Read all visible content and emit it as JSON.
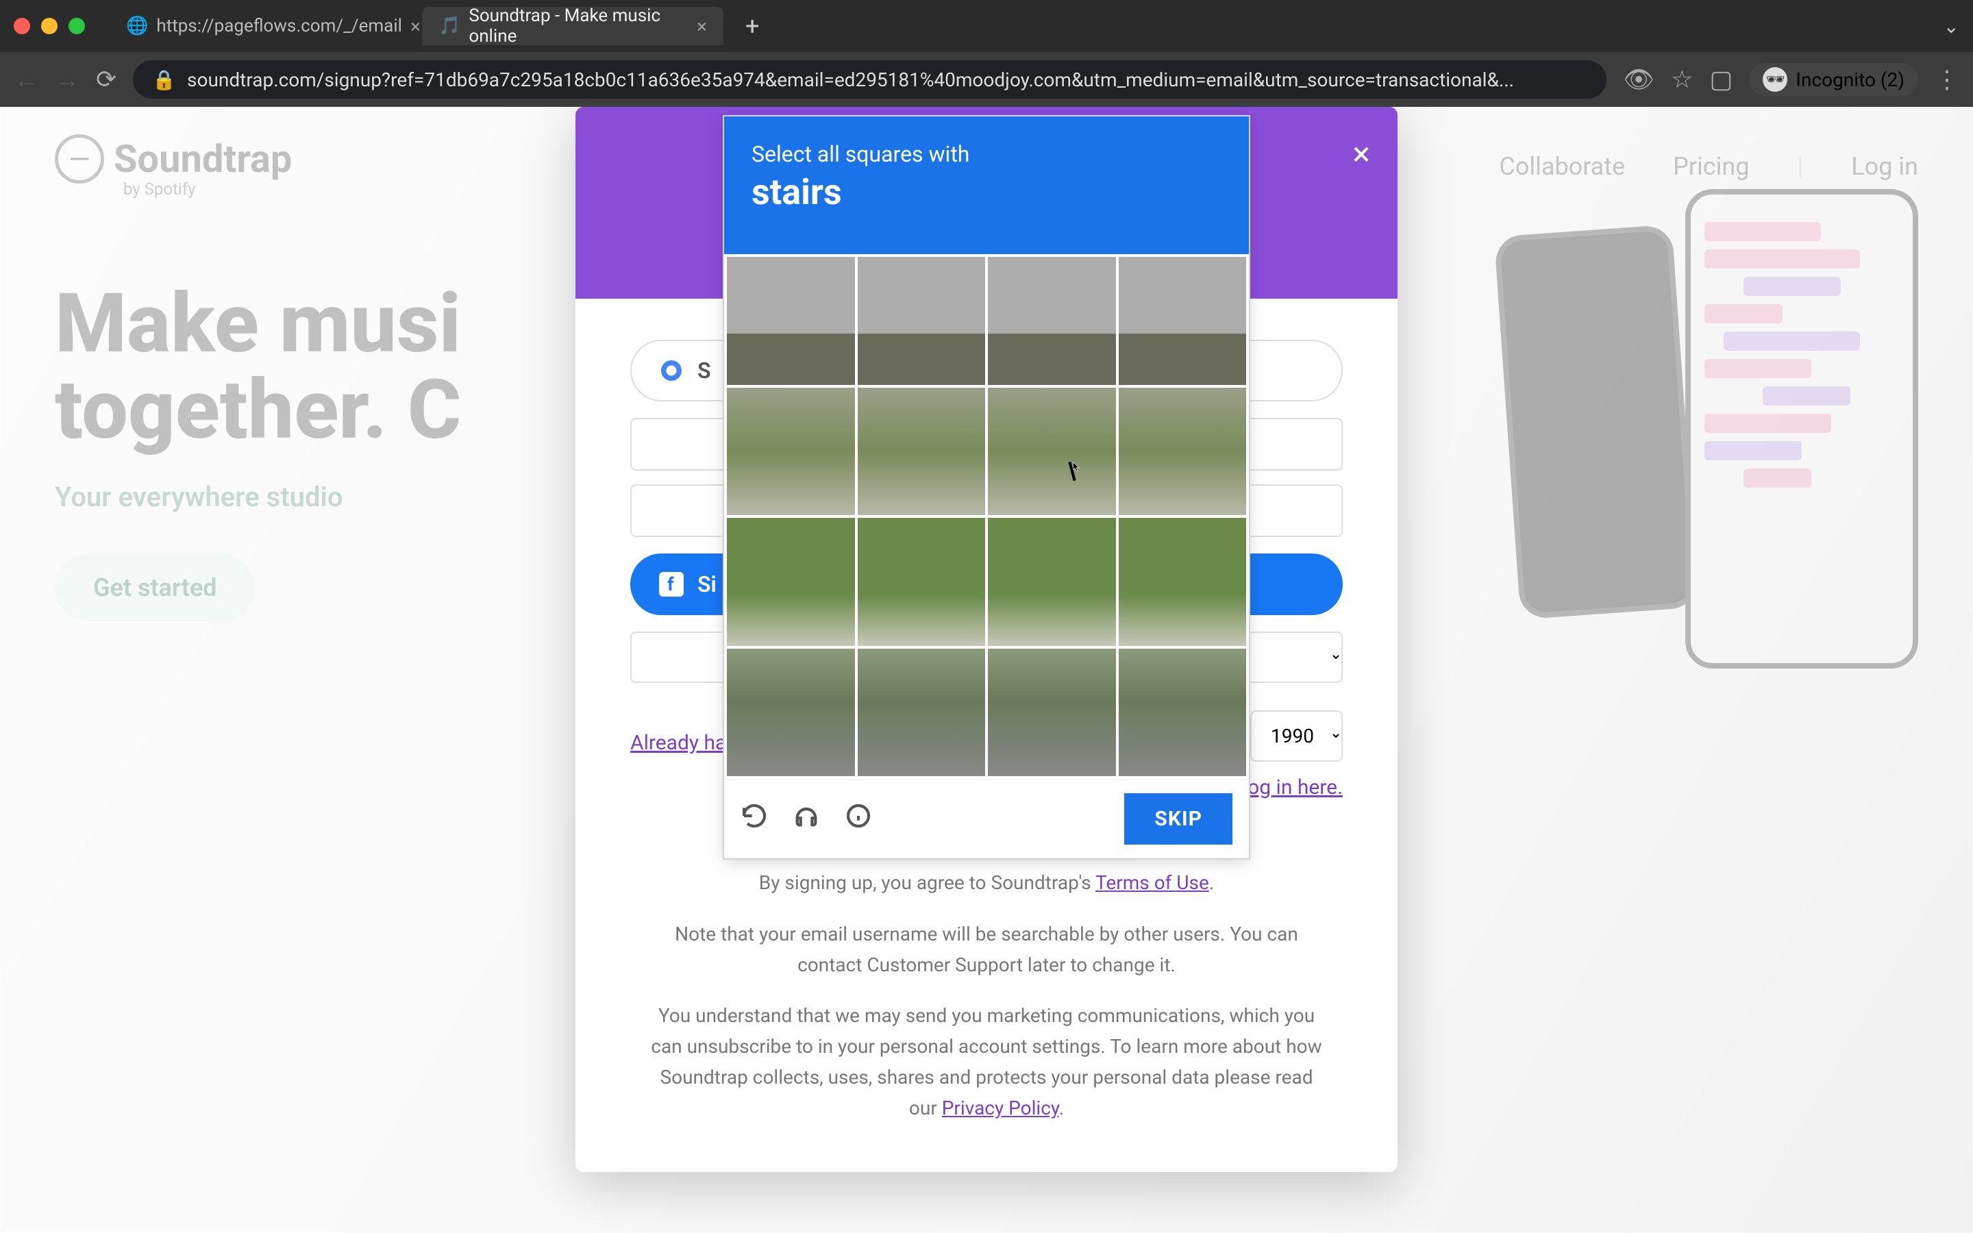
{
  "browser": {
    "tabs": [
      {
        "title": "https://pageflows.com/_/email",
        "active": false
      },
      {
        "title": "Soundtrap - Make music online",
        "active": true
      }
    ],
    "url": "soundtrap.com/signup?ref=71db69a7c295a18cb0c11a636e35a974&email=ed295181%40moodjoy.com&utm_medium=email&utm_source=transactional&...",
    "incognito_label": "Incognito (2)"
  },
  "site": {
    "logo_text": "Soundtrap",
    "logo_sub": "by Spotify",
    "nav": {
      "collaborate": "Collaborate",
      "pricing": "Pricing",
      "login": "Log in"
    },
    "hero_title_line1": "Make musi",
    "hero_title_line2": "together. C",
    "hero_sub": "Your everywhere studio",
    "get_started": "Get started"
  },
  "signup": {
    "google_label": "S",
    "facebook_label": "Si",
    "already_label": "Already ha",
    "year_value": "1990",
    "login_here": "Log in here.",
    "legal1_prefix": "By signing up, you agree to Soundtrap's ",
    "legal1_link": "Terms of Use",
    "legal1_suffix": ".",
    "legal2": "Note that your email username will be searchable by other users. You can contact Customer Support later to change it.",
    "legal3_prefix": "You understand that we may send you marketing communications, which you can unsubscribe to in your personal account settings. To learn more about how Soundtrap collects, uses, shares and protects your personal data please read our ",
    "legal3_link": "Privacy Policy",
    "legal3_suffix": "."
  },
  "recaptcha": {
    "instruction": "Select all squares with",
    "target": "stairs",
    "skip_label": "SKIP",
    "grid_rows": 4,
    "grid_cols": 4
  }
}
